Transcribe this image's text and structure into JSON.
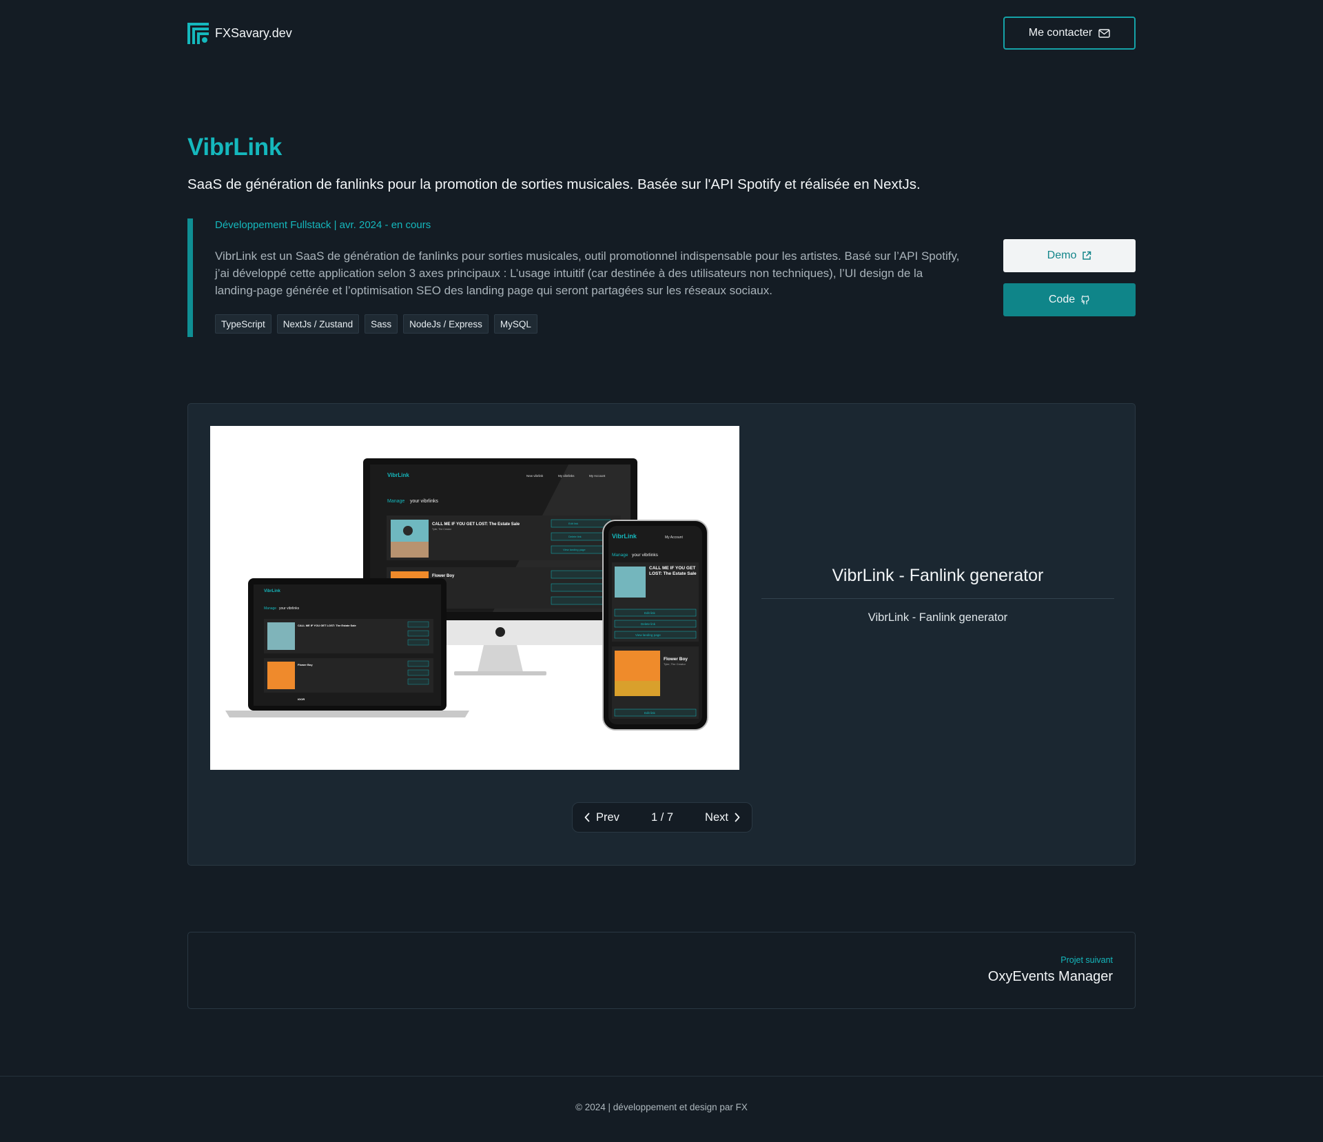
{
  "brand": {
    "name": "FXSavary.dev",
    "logo_icon": "fx-logo-icon"
  },
  "header": {
    "contact_label": "Me contacter",
    "contact_icon": "mail-icon"
  },
  "project": {
    "title": "VibrLink",
    "subtitle": "SaaS de génération de fanlinks pour la promotion de sorties musicales. Basée sur l'API Spotify et réalisée en NextJs.",
    "meta": "Développement Fullstack | avr. 2024 - en cours",
    "description": "VibrLink est un SaaS de génération de fanlinks pour sorties musicales, outil promotionnel indispensable pour les artistes. Basé sur l’API Spotify, j’ai développé cette application selon 3 axes principaux : L’usage intuitif (car destinée à des utilisateurs non techniques), l’UI design de la landing-page générée et l’optimisation SEO des landing page qui seront partagées sur les réseaux sociaux.",
    "tags": [
      "TypeScript",
      "NextJs / Zustand",
      "Sass",
      "NodeJs / Express",
      "MySQL"
    ]
  },
  "actions": {
    "demo_label": "Demo",
    "demo_icon": "external-link-icon",
    "code_label": "Code",
    "code_icon": "github-icon"
  },
  "gallery": {
    "caption_title": "VibrLink - Fanlink generator",
    "caption_sub": "VibrLink - Fanlink generator",
    "prev_label": "Prev",
    "next_label": "Next",
    "counter": "1 / 7",
    "mockup": {
      "brand": "VibrLink",
      "nav": [
        "New vibrlink",
        "My vibrlinks",
        "My Account"
      ],
      "heading_accent": "Manage",
      "heading_rest": " your vibrlinks",
      "items": [
        {
          "title": "CALL ME IF YOU GET LOST: The Estate Sale",
          "artist": "Tyler, The Creator"
        },
        {
          "title": "Flower Boy",
          "artist": "Tyler, The Creator"
        },
        {
          "title": "IGOR",
          "artist": ""
        }
      ],
      "actions": [
        "Edit link",
        "Delete link",
        "View landing page"
      ],
      "phone_account": "My Account",
      "phone_item_title": "CALL ME IF YOU GET LOST: The Estate Sale"
    }
  },
  "next_project": {
    "label": "Projet suivant",
    "title": "OxyEvents Manager"
  },
  "footer": {
    "text": "© 2024 | développement et design par FX"
  },
  "colors": {
    "accent": "#15b8bd",
    "background": "#141c24",
    "panel": "#1b2731"
  }
}
